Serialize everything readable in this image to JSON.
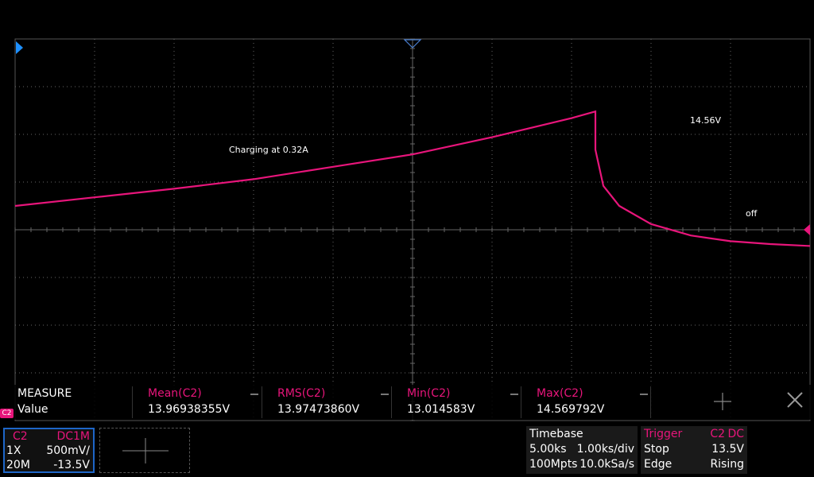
{
  "colors": {
    "trace": "#e8157b",
    "grid": "#666666",
    "accent_blue": "#1e66c8",
    "label_pink": "#e8157b"
  },
  "annotations": {
    "charging": "Charging at 0.32A",
    "peak": "14.56V",
    "off": "off"
  },
  "measure": {
    "title": "MEASURE",
    "row_label": "Value",
    "items": [
      {
        "name": "Mean(C2)",
        "value": "13.96938355V"
      },
      {
        "name": "RMS(C2)",
        "value": "13.97473860V"
      },
      {
        "name": "Min(C2)",
        "value": "13.014583V"
      },
      {
        "name": "Max(C2)",
        "value": "14.569792V"
      }
    ]
  },
  "channel_tag": "C2",
  "channel": {
    "name": "C2",
    "coupling": "DC1M",
    "probe": "1X",
    "scale": "500mV/",
    "bandwidth": "20M",
    "offset": "-13.5V"
  },
  "timebase": {
    "title": "Timebase",
    "delay": "5.00ks",
    "scale": "1.00ks/div",
    "memory": "100Mpts",
    "sample_rate": "10.0kSa/s"
  },
  "trigger": {
    "title": "Trigger",
    "source": "C2",
    "coupling": "DC",
    "mode": "Stop",
    "level": "13.5V",
    "type": "Edge",
    "slope": "Rising"
  },
  "chart_data": {
    "type": "line",
    "series": [
      {
        "name": "C2",
        "t_div": [
          0,
          1,
          2,
          3,
          4,
          5,
          6,
          7,
          7.3,
          7.3,
          7.4,
          7.6,
          8,
          8.5,
          9,
          9.5,
          10
        ],
        "v": [
          13.97,
          14.06,
          14.15,
          14.25,
          14.38,
          14.51,
          14.69,
          14.89,
          14.96,
          14.56,
          14.18,
          13.97,
          13.78,
          13.66,
          13.6,
          13.57,
          13.55
        ]
      }
    ],
    "x_unit": "ks",
    "y_unit": "V",
    "grid": true
  }
}
